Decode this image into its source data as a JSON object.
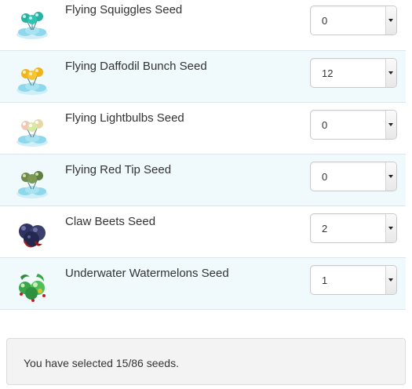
{
  "seeds": [
    {
      "name": "Flying Squiggles Seed",
      "quantity": "0",
      "icon": "flying-squiggles-seed-icon",
      "balloon_color": "#2ab7a7"
    },
    {
      "name": "Flying Daffodil Bunch Seed",
      "quantity": "12",
      "icon": "flying-daffodil-seed-icon",
      "balloon_color": "#f2b21a"
    },
    {
      "name": "Flying Lightbulbs Seed",
      "quantity": "0",
      "icon": "flying-lightbulbs-seed-icon",
      "balloon_color": "#f3d2c0"
    },
    {
      "name": "Flying Red Tip Seed",
      "quantity": "0",
      "icon": "flying-red-tip-seed-icon",
      "balloon_color": "#6e8b4a"
    },
    {
      "name": "Claw Beets Seed",
      "quantity": "2",
      "icon": "claw-beets-seed-icon",
      "balloon_color": "#3b3f6e"
    },
    {
      "name": "Underwater Watermelons Seed",
      "quantity": "1",
      "icon": "underwater-watermelons-seed-icon",
      "balloon_color": "#3aa64a"
    }
  ],
  "summary": {
    "text": "You have selected 15/86 seeds."
  },
  "colors": {
    "row_alt_bg": "#f0fafd",
    "summary_bg": "#f3f3f3"
  }
}
